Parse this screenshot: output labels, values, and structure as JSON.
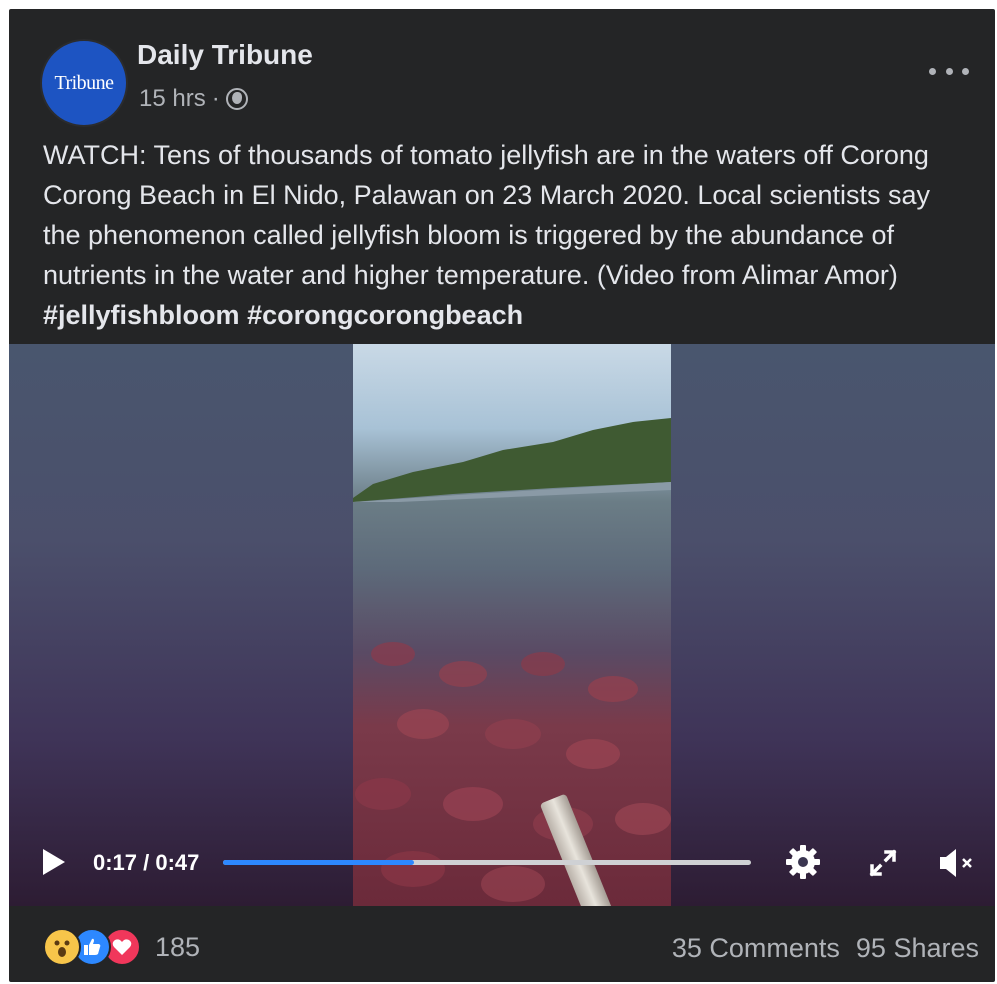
{
  "post": {
    "page_name": "Daily Tribune",
    "avatar_text": "Tribune",
    "timestamp": "15 hrs",
    "separator": "·",
    "caption_text": "WATCH: Tens of thousands of tomato jellyfish are in the waters off Corong Corong Beach in El Nido, Palawan on 23 March 2020. Local scientists say the phenomenon called jellyfish bloom is triggered by the abundance of nutrients in the water and higher temperature. (Video from Alimar Amor) ",
    "hashtags": [
      "#jellyfishbloom",
      "#corongcorongbeach"
    ]
  },
  "video": {
    "time_display": "0:17 / 0:47",
    "progress_fraction": 0.362
  },
  "footer": {
    "reaction_count": "185",
    "comments": "35 Comments",
    "shares": "95 Shares"
  },
  "icons": {
    "privacy": "globe-icon",
    "more": "more-options-icon",
    "play": "play-icon",
    "settings": "gear-icon",
    "fullscreen": "expand-icon",
    "volume": "muted-speaker-icon",
    "reactions": [
      "wow-reaction-icon",
      "like-reaction-icon",
      "love-reaction-icon"
    ]
  },
  "colors": {
    "card_background": "#242526",
    "primary_text": "#e4e6eb",
    "secondary_text": "#b0b3b8",
    "progress_accent": "#2d88ff"
  }
}
